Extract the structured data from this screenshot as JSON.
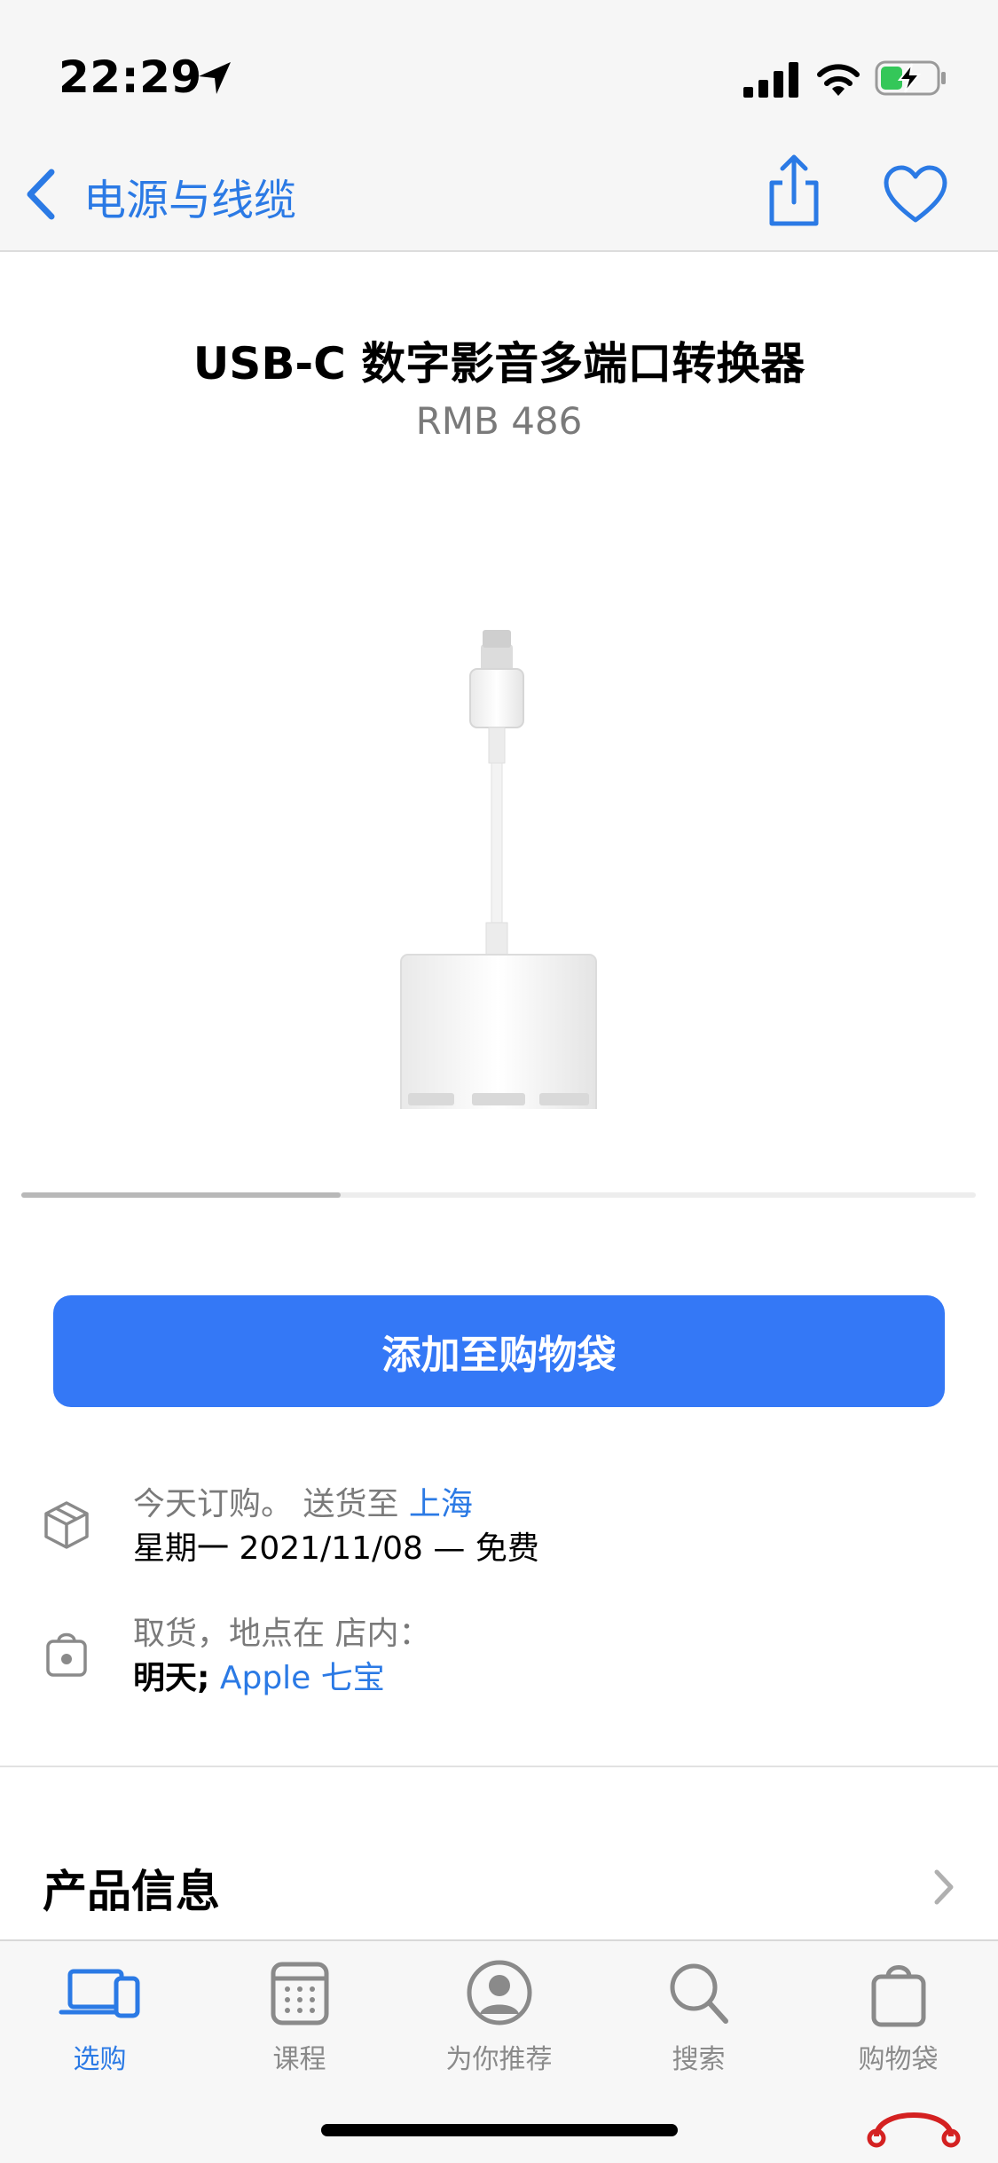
{
  "status_bar": {
    "time": "22:29",
    "icons": [
      "location-arrow-icon",
      "cellular-signal-icon",
      "wifi-icon",
      "battery-charging-icon"
    ],
    "battery_color": "#34c759"
  },
  "nav": {
    "back_label": "电源与线缆",
    "icons": [
      "back-chevron-icon",
      "share-icon",
      "heart-icon"
    ]
  },
  "product": {
    "title": "USB-C 数字影音多端口转换器",
    "price": "RMB 486",
    "gallery_progress": 0.33
  },
  "actions": {
    "add_to_bag_label": "添加至购物袋"
  },
  "delivery": {
    "line1_prefix": "今天订购。 送货至 ",
    "line1_location": "上海",
    "line2": "星期一 2021/11/08 — 免费",
    "icon": "package-box-icon"
  },
  "pickup": {
    "line1": "取货，地点在 店内：",
    "line2_prefix": "明天;",
    "line2_store": " Apple 七宝",
    "icon": "bag-icon"
  },
  "product_info": {
    "title": "产品信息"
  },
  "tab_bar": {
    "tabs": [
      {
        "label": "选购",
        "icon": "laptop-phone-icon",
        "active": true
      },
      {
        "label": "课程",
        "icon": "calendar-icon",
        "active": false
      },
      {
        "label": "为你推荐",
        "icon": "person-circle-icon",
        "active": false
      },
      {
        "label": "搜索",
        "icon": "search-icon",
        "active": false
      },
      {
        "label": "购物袋",
        "icon": "bag-icon",
        "active": false
      }
    ]
  },
  "colors": {
    "accent": "#2b7ae5",
    "button": "#3478f6"
  }
}
